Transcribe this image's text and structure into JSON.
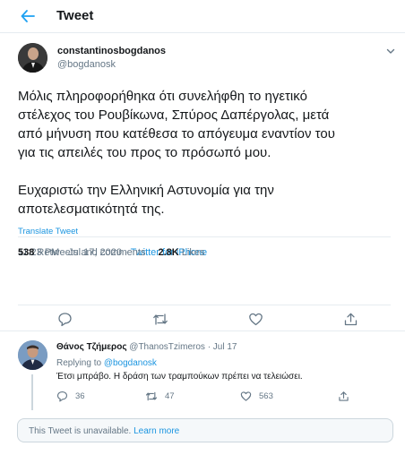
{
  "header": {
    "title": "Tweet",
    "back_icon": "arrow-left-icon"
  },
  "tweet": {
    "display_name": "constantinosbogdanos",
    "handle": "@bogdanosk",
    "text": "Μόλις πληροφορήθηκα ότι συνελήφθη το ηγετικό\nστέλεχος του Ρουβίκωνα, Σπύρος Δαπέργολας, μετά\nαπό μήνυση που κατέθεσα το απόγευμα εναντίον του\nγια τις απειλές του προς το πρόσωπό μου.\n\nΕυχαριστώ την Ελληνική Αστυνομία για την\nαποτελεσματικότητά της.",
    "translate": "Translate Tweet",
    "time": "11:23 PM · Jul 17, 2020 · ",
    "source": "Twitter for iPhone",
    "retweets_count": "538",
    "retweets_label": "Retweets and comments",
    "likes_count": "2.8K",
    "likes_label": "Likes"
  },
  "reply": {
    "name": "Θάνος Τζήμερος",
    "handle_date": " @ThanosTzimeros · Jul 17",
    "replying_prefix": "Replying to ",
    "replying_to": "@bogdanosk",
    "text": "Έτσι μπράβο. Η δράση των τραμπούκων πρέπει να τελειώσει.",
    "replies": "36",
    "retweets": "47",
    "likes": "563"
  },
  "unavailable": {
    "text": "This Tweet is unavailable. ",
    "link": "Learn more"
  },
  "colors": {
    "accent": "#1b95e0",
    "muted": "#657786",
    "border": "#e6ecf0"
  }
}
